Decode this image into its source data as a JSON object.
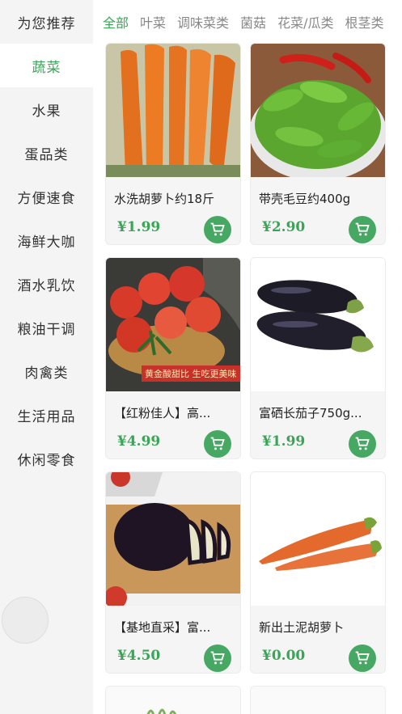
{
  "sidebar": {
    "items": [
      {
        "label": "为您推荐"
      },
      {
        "label": "蔬菜"
      },
      {
        "label": "水果"
      },
      {
        "label": "蛋品类"
      },
      {
        "label": "方便速食"
      },
      {
        "label": "海鲜大咖"
      },
      {
        "label": "酒水乳饮"
      },
      {
        "label": "粮油干调"
      },
      {
        "label": "肉禽类"
      },
      {
        "label": "生活用品"
      },
      {
        "label": "休闲零食"
      }
    ],
    "active_index": 1
  },
  "tabs": [
    {
      "label": "全部"
    },
    {
      "label": "叶菜"
    },
    {
      "label": "调味菜类"
    },
    {
      "label": "菌菇"
    },
    {
      "label": "花菜/瓜类"
    },
    {
      "label": "根茎类"
    }
  ],
  "products": [
    {
      "name": "水洗胡萝卜约18斤",
      "price": "¥1.99"
    },
    {
      "name": "带壳毛豆约400g",
      "price": "¥2.90"
    },
    {
      "name": "【红粉佳人】高...",
      "price": "¥4.99",
      "tag": "黄金酸甜比 生吃更美味"
    },
    {
      "name": "富硒长茄子750g...",
      "price": "¥1.99"
    },
    {
      "name": "【基地直采】富...",
      "price": "¥4.50"
    },
    {
      "name": "新出土泥胡萝卜",
      "price": "¥0.00"
    }
  ],
  "colors": {
    "accent": "#3aa556",
    "cart": "#46a863"
  }
}
